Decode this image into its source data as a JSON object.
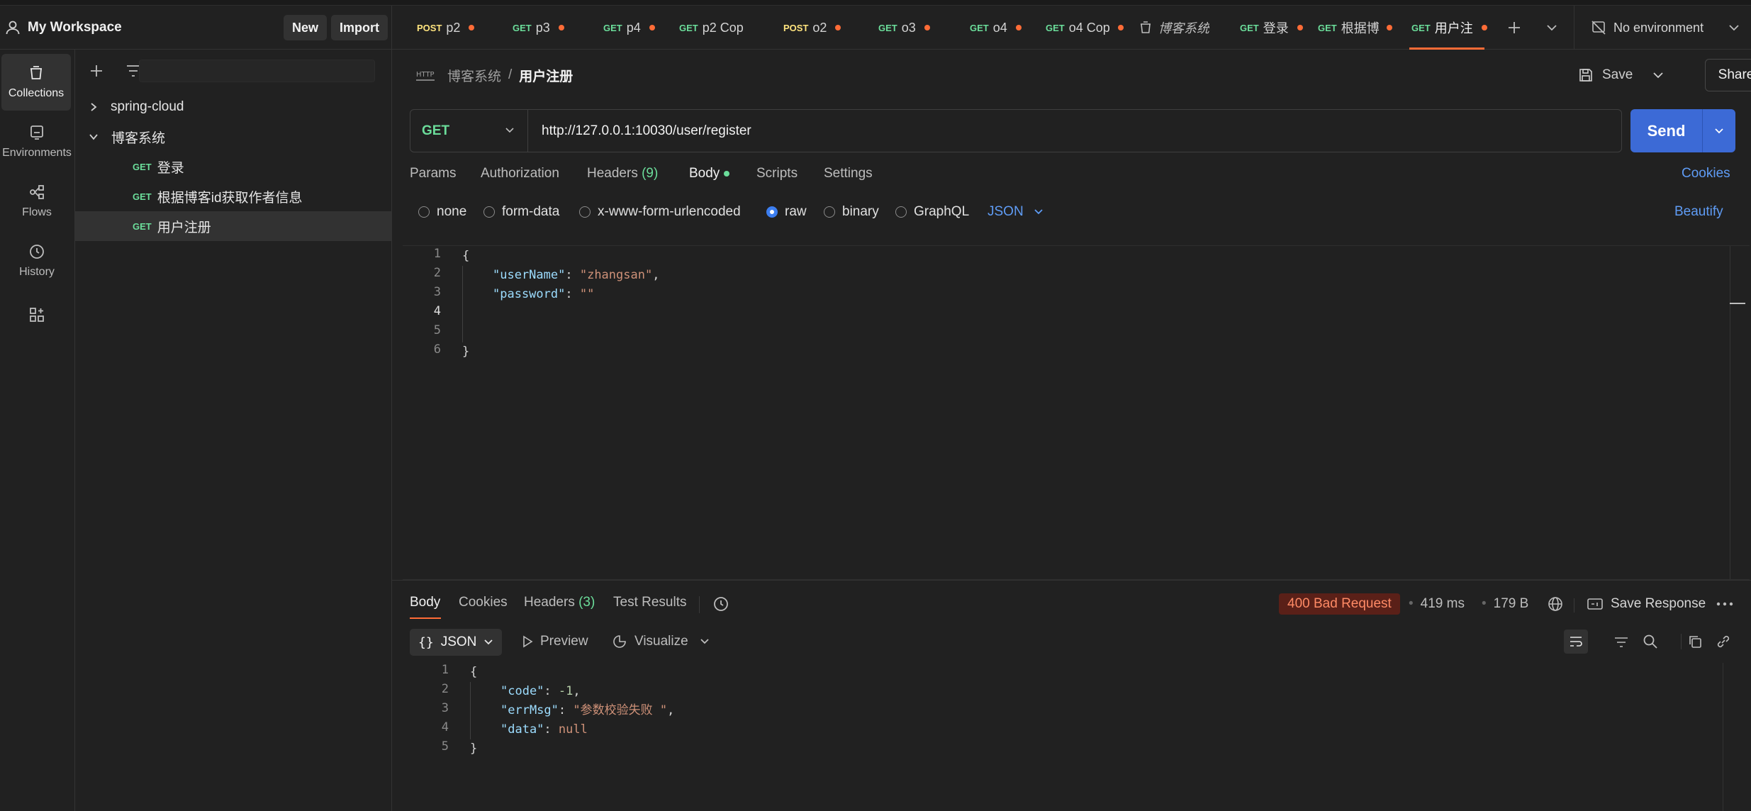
{
  "workspace": {
    "title": "My Workspace",
    "new_label": "New",
    "import_label": "Import"
  },
  "rail": [
    {
      "label": "Collections",
      "icon": "collections-icon"
    },
    {
      "label": "Environments",
      "icon": "environments-icon"
    },
    {
      "label": "Flows",
      "icon": "flows-icon"
    },
    {
      "label": "History",
      "icon": "history-icon"
    },
    {
      "label": "",
      "icon": "add-apps-icon"
    }
  ],
  "sidebar": {
    "tree": [
      {
        "label": "spring-cloud",
        "method": ""
      },
      {
        "label": "博客系统",
        "method": ""
      },
      {
        "label": "登录",
        "method": "GET"
      },
      {
        "label": "根据博客id获取作者信息",
        "method": "GET"
      },
      {
        "label": "用户注册",
        "method": "GET"
      }
    ]
  },
  "tabs": [
    {
      "method": "POST",
      "label": "p2"
    },
    {
      "method": "GET",
      "label": "p3"
    },
    {
      "method": "GET",
      "label": "p4"
    },
    {
      "method": "GET",
      "label": "p2 Cop"
    },
    {
      "method": "POST",
      "label": "o2"
    },
    {
      "method": "GET",
      "label": "o3"
    },
    {
      "method": "GET",
      "label": "o4"
    },
    {
      "method": "GET",
      "label": "o4 Cop"
    },
    {
      "method": "",
      "label": "博客系统"
    },
    {
      "method": "GET",
      "label": "登录"
    },
    {
      "method": "GET",
      "label": "根据博"
    },
    {
      "method": "GET",
      "label": "用户注"
    }
  ],
  "environment": {
    "label": "No environment"
  },
  "request": {
    "breadcrumb_parent": "博客系统",
    "breadcrumb_sep": "/",
    "breadcrumb_current": "用户注册",
    "save_label": "Save",
    "share_label": "Share",
    "method": "GET",
    "url": "http://127.0.0.1:10030/user/register",
    "send_label": "Send",
    "tabs": {
      "params": "Params",
      "authorization": "Authorization",
      "headers": "Headers",
      "headers_count": "(9)",
      "body": "Body",
      "scripts": "Scripts",
      "settings": "Settings",
      "cookies": "Cookies"
    },
    "body_types": [
      "none",
      "form-data",
      "x-www-form-urlencoded",
      "raw",
      "binary",
      "GraphQL"
    ],
    "body_type_selected": "raw",
    "raw_format": "JSON",
    "beautify_label": "Beautify",
    "body_lines": [
      "1",
      "2",
      "3",
      "4",
      "5",
      "6"
    ],
    "body_code": {
      "open": "{",
      "k1": "\"userName\"",
      "v1": "\"zhangsan\"",
      "k2": "\"password\"",
      "v2": "\"\"",
      "close": "}"
    }
  },
  "response": {
    "tabs": {
      "body": "Body",
      "cookies": "Cookies",
      "headers": "Headers",
      "headers_count": "(3)",
      "test_results": "Test Results"
    },
    "status": "400 Bad Request",
    "time": "419 ms",
    "size": "179 B",
    "save_response_label": "Save Response",
    "format": "JSON",
    "preview_label": "Preview",
    "visualize_label": "Visualize",
    "lines": [
      "1",
      "2",
      "3",
      "4",
      "5"
    ],
    "code": {
      "open": "{",
      "k1": "\"code\"",
      "v1": "-1",
      "k2": "\"errMsg\"",
      "v2": "\"参数校验失败 \"",
      "k3": "\"data\"",
      "v3": "null",
      "close": "}"
    }
  },
  "colors": {
    "accent": "#ff6c37",
    "send": "#3c6ad6",
    "get": "#6bdd9a",
    "post": "#ffe47e",
    "error_badge": "#5a2018"
  }
}
